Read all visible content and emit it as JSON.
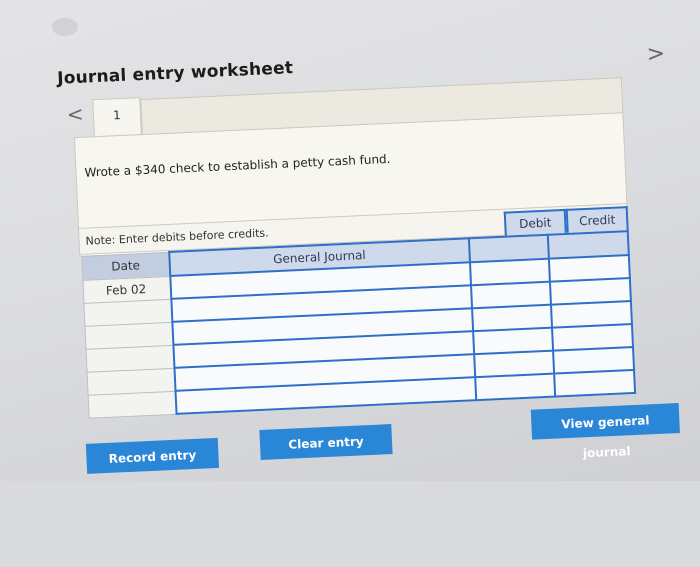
{
  "worksheet": {
    "title": "Journal entry worksheet",
    "prev_glyph": "<",
    "next_glyph": ">",
    "tabs": [
      {
        "label": "1"
      }
    ],
    "question": "Wrote a $340 check to establish a petty cash fund.",
    "note": "Note: Enter debits before credits."
  },
  "journal": {
    "headers": {
      "date": "Date",
      "general_journal": "General Journal",
      "debit": "Debit",
      "credit": "Credit"
    },
    "rows": [
      {
        "date": "Feb 02",
        "account": "",
        "debit": "",
        "credit": ""
      },
      {
        "date": "",
        "account": "",
        "debit": "",
        "credit": ""
      },
      {
        "date": "",
        "account": "",
        "debit": "",
        "credit": ""
      },
      {
        "date": "",
        "account": "",
        "debit": "",
        "credit": ""
      },
      {
        "date": "",
        "account": "",
        "debit": "",
        "credit": ""
      },
      {
        "date": "",
        "account": "",
        "debit": "",
        "credit": ""
      }
    ]
  },
  "buttons": {
    "record": "Record entry",
    "clear": "Clear entry",
    "view": "View general journal"
  },
  "colors": {
    "button": "#2a86d6",
    "grid_border": "#2f6fc8",
    "header_bg": "#cfd9ec"
  }
}
